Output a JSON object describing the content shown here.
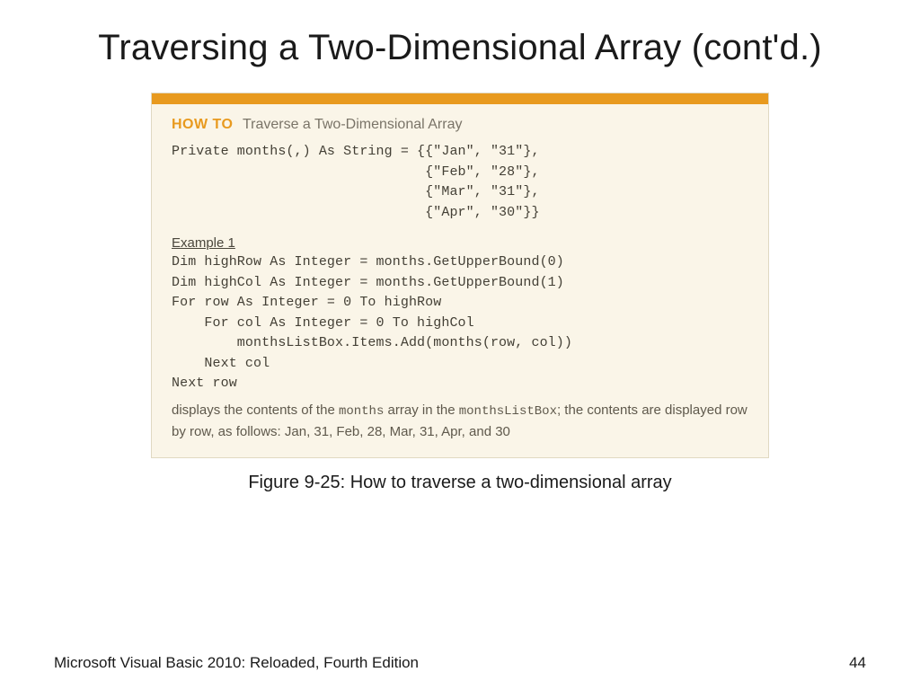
{
  "slide": {
    "title": "Traversing a Two-Dimensional Array (cont'd.)",
    "caption": "Figure 9-25: How to traverse a two-dimensional array"
  },
  "howto": {
    "label": "HOW TO",
    "title": "Traverse a Two-Dimensional Array"
  },
  "code": {
    "declaration": "Private months(,) As String = {{\"Jan\", \"31\"},\n                               {\"Feb\", \"28\"},\n                               {\"Mar\", \"31\"},\n                               {\"Apr\", \"30\"}}",
    "example_label": "Example 1",
    "example_body": "Dim highRow As Integer = months.GetUpperBound(0)\nDim highCol As Integer = months.GetUpperBound(1)\nFor row As Integer = 0 To highRow\n    For col As Integer = 0 To highCol\n        monthsListBox.Items.Add(months(row, col))\n    Next col\nNext row"
  },
  "desc": {
    "p1": "displays the contents of the ",
    "p2": "months",
    "p3": " array in the ",
    "p4": "monthsListBox",
    "p5": "; the contents are displayed row by row, as follows: Jan, 31, Feb, 28, Mar, 31, Apr, and 30"
  },
  "footer": {
    "left": "Microsoft Visual Basic 2010: Reloaded, Fourth Edition",
    "page": "44"
  }
}
